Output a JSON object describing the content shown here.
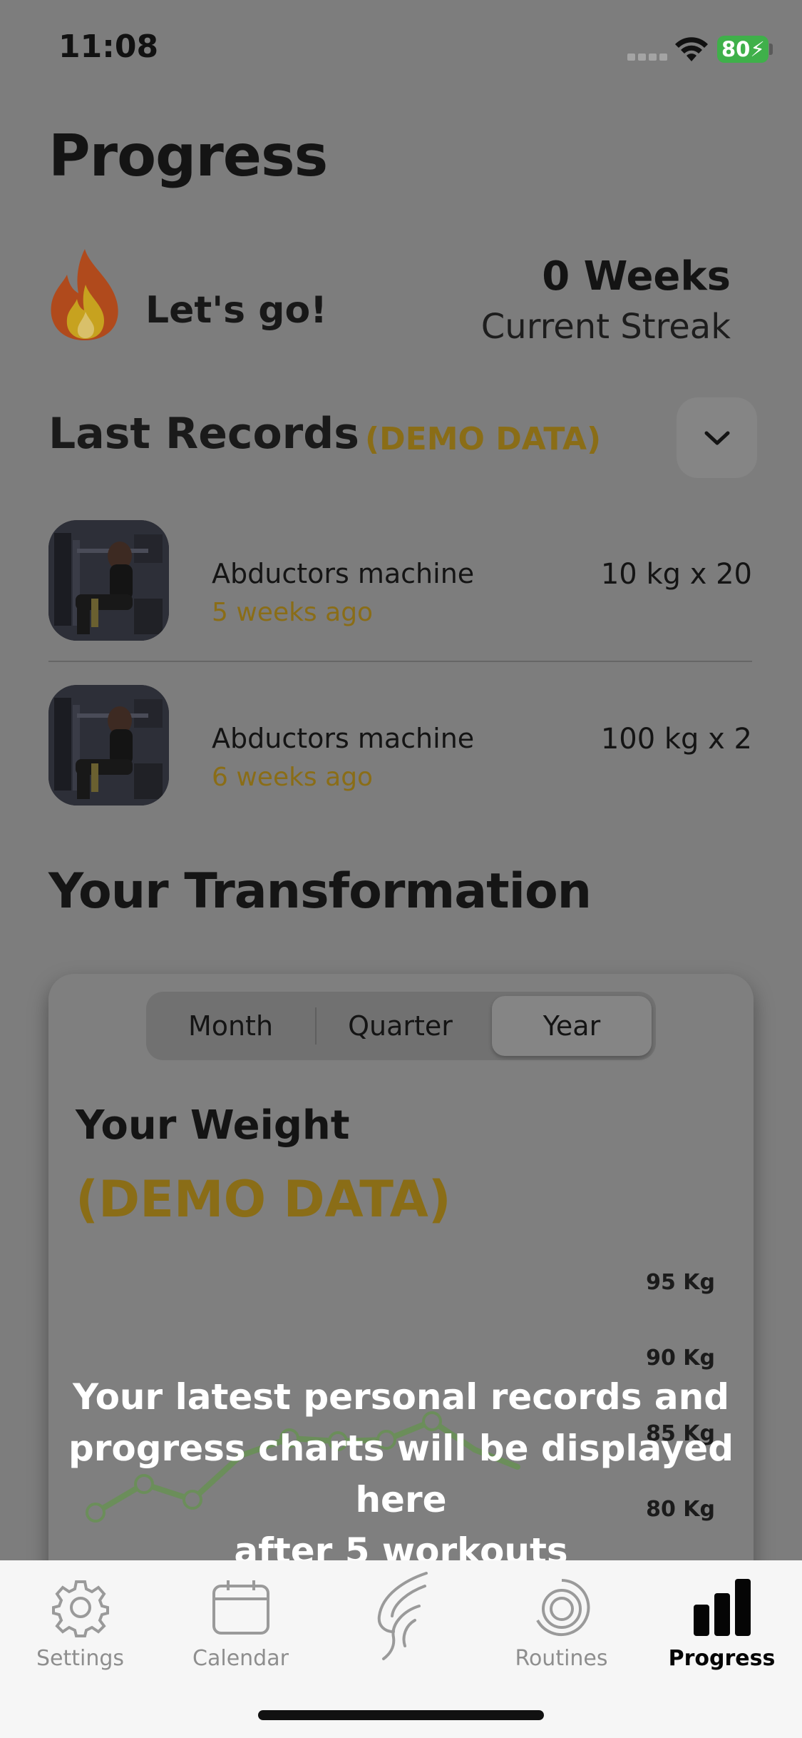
{
  "status_bar": {
    "time": "11:08",
    "battery": "80"
  },
  "page": {
    "title": "Progress"
  },
  "streak": {
    "motivation": "Let's go!",
    "value": "0 Weeks",
    "label": "Current Streak"
  },
  "records": {
    "title": "Last Records",
    "demo_tag": "(DEMO DATA)",
    "items": [
      {
        "name": "Abductors machine",
        "when": "5 weeks ago",
        "weight": "10 kg x  20"
      },
      {
        "name": "Abductors machine",
        "when": "6 weeks ago",
        "weight": "100 kg x  2"
      }
    ]
  },
  "transformation": {
    "title": "Your Transformation",
    "periods": [
      "Month",
      "Quarter",
      "Year"
    ],
    "selected_period": "Year",
    "weight_title": "Your Weight",
    "demo_tag": "(DEMO DATA)",
    "y_labels": [
      "95 Kg",
      "90 Kg",
      "85 Kg",
      "80 Kg"
    ],
    "overlay_lines": [
      "Your latest personal records and",
      "progress charts will be displayed here",
      "after 5 workouts"
    ]
  },
  "tab_bar": {
    "items": [
      {
        "label": "Settings",
        "icon": "gear-icon",
        "active": false
      },
      {
        "label": "Calendar",
        "icon": "calendar-icon",
        "active": false
      },
      {
        "label": "",
        "icon": "brand-logo-icon",
        "active": false
      },
      {
        "label": "Routines",
        "icon": "routines-icon",
        "active": false
      },
      {
        "label": "Progress",
        "icon": "bar-chart-icon",
        "active": true
      }
    ]
  },
  "colors": {
    "accent": "#8a6d17",
    "chart_line": "#6b8e5a",
    "battery": "#3fb04a"
  }
}
